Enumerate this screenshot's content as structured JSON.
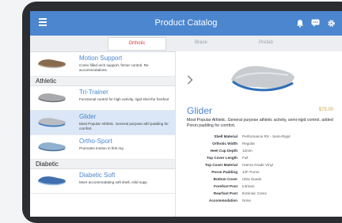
{
  "header": {
    "title": "Product Catalog"
  },
  "tabs": [
    {
      "label": "Orthotic",
      "active": true
    },
    {
      "label": "Brace",
      "active": false
    },
    {
      "label": "Prefab",
      "active": false
    }
  ],
  "list": {
    "items": [
      {
        "title": "Motion Support",
        "desc": "Corex filled arch support, firmer control. Re accommodations."
      },
      {
        "section": "Athletic"
      },
      {
        "title": "Tri-Trainer",
        "desc": "Functional control for high activity, rigid shel the forefoot"
      },
      {
        "title": "Glider",
        "desc": "Most Popular Athletic. General purpose athl padding for comfort.",
        "selected": true
      },
      {
        "title": "Ortho-Sport",
        "desc": "Promotes motion in first ray."
      },
      {
        "section": "Diabetic"
      },
      {
        "title": "Diabetic Soft",
        "desc": "More accommodating soft shell, mild supp"
      }
    ]
  },
  "detail": {
    "title": "Glider",
    "price": "$75.00",
    "description": "Most Popular Athletic. General purpose athletic activity, semi-rigid control, added Poron padding for comfort.",
    "specs": [
      {
        "label": "Shell Material",
        "value": "Performance RX - Semi-Rigid"
      },
      {
        "label": "Orthotic Width",
        "value": "Regular"
      },
      {
        "label": "Heel Cup Depth",
        "value": "12mm"
      },
      {
        "label": "Top Cover Length",
        "value": "Full"
      },
      {
        "label": "Top Cover Material",
        "value": "Hamra Grade Vinyl"
      },
      {
        "label": "Poron Padding",
        "value": "1/8\" Poron"
      },
      {
        "label": "Bottom Cover",
        "value": "Ultra Suede"
      },
      {
        "label": "Forefoot Post",
        "value": "Intrinsic"
      },
      {
        "label": "Rearfoot Post",
        "value": "Extrinsic Corex"
      },
      {
        "label": "Accommodation",
        "value": "None"
      }
    ]
  },
  "colors": {
    "accent": "#4b86cf",
    "tab_active": "#d23b3b",
    "price": "#c9a64a"
  },
  "icons": [
    "menu-icon",
    "bell-icon",
    "chat-icon",
    "gear-icon",
    "chevron-right-icon"
  ]
}
